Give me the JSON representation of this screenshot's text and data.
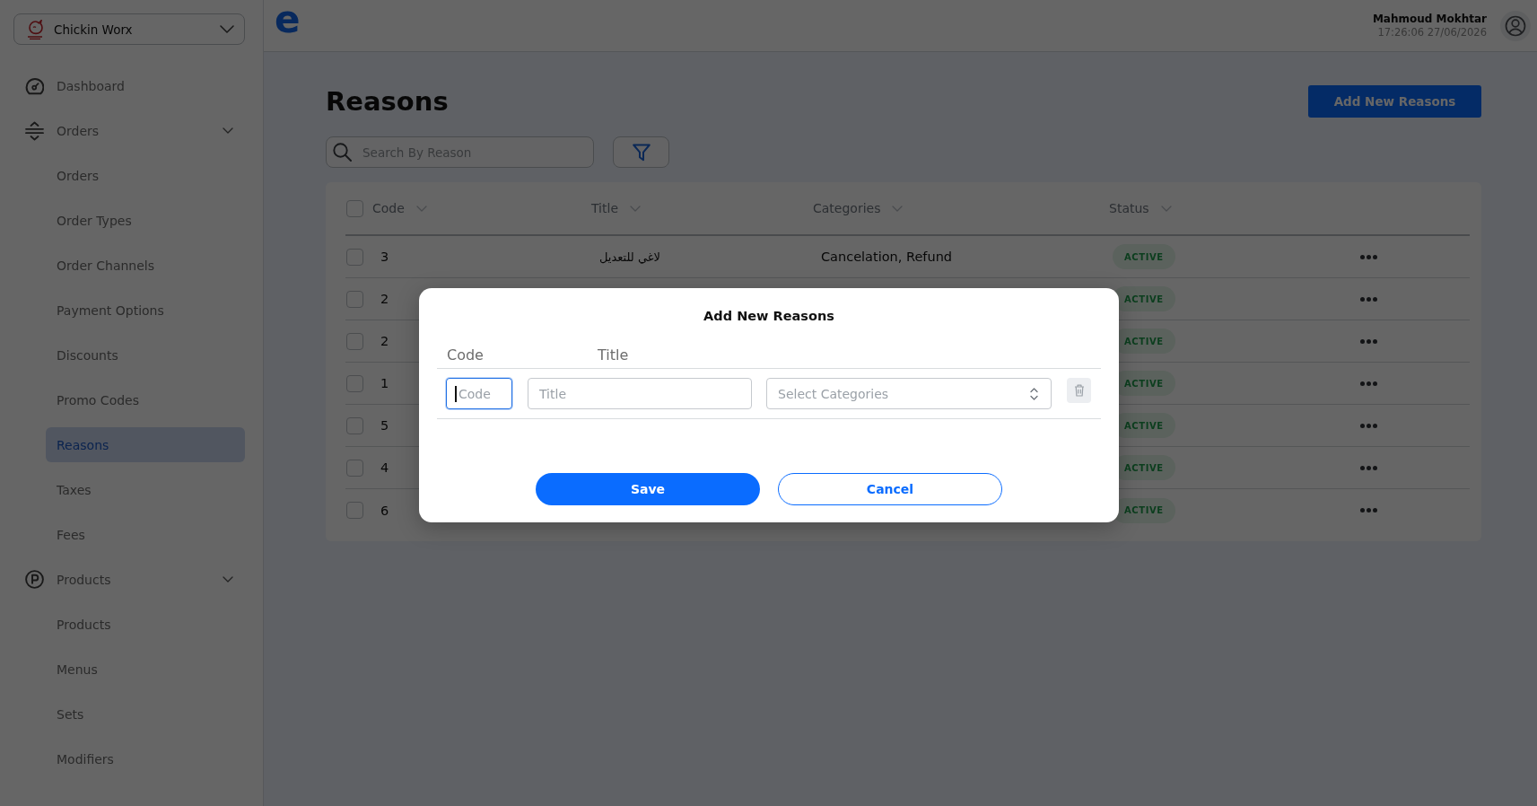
{
  "sidebar": {
    "brand_selector": {
      "label": "Chickin Worx"
    },
    "nav": [
      {
        "label": "Dashboard",
        "selected": false
      },
      {
        "label": "Orders",
        "selected": false,
        "expanded": true,
        "children": [
          {
            "label": "Orders",
            "selected": false
          },
          {
            "label": "Order Types",
            "selected": false
          },
          {
            "label": "Order Channels",
            "selected": false
          },
          {
            "label": "Payment Options",
            "selected": false
          },
          {
            "label": "Discounts",
            "selected": false
          },
          {
            "label": "Promo Codes",
            "selected": false
          },
          {
            "label": "Reasons",
            "selected": true
          },
          {
            "label": "Taxes",
            "selected": false
          },
          {
            "label": "Fees",
            "selected": false
          }
        ]
      },
      {
        "label": "Products",
        "selected": false,
        "expanded": true,
        "children": [
          {
            "label": "Products",
            "selected": false
          },
          {
            "label": "Menus",
            "selected": false
          },
          {
            "label": "Sets",
            "selected": false
          },
          {
            "label": "Modifiers",
            "selected": false
          }
        ]
      }
    ]
  },
  "header": {
    "logo": "e",
    "user": {
      "name": "Mahmoud Mokhtar",
      "timestamp": "17:26:06 27/06/2026"
    }
  },
  "page": {
    "title": "Reasons",
    "add_button": "Add New Reasons",
    "search": {
      "placeholder": "Search By Reason"
    },
    "table": {
      "select_all_checked": false,
      "columns": [
        "Code",
        "Title",
        "Categories",
        "Status"
      ],
      "rows": [
        {
          "code": "3",
          "title": "لاغي للتعديل",
          "categories": "Cancelation, Refund",
          "status": "ACTIVE",
          "checked": false
        },
        {
          "code": "2",
          "status": "ACTIVE",
          "checked": false
        },
        {
          "code": "2",
          "status": "ACTIVE",
          "checked": false
        },
        {
          "code": "1",
          "status": "ACTIVE",
          "checked": false
        },
        {
          "code": "5",
          "status": "ACTIVE",
          "checked": false
        },
        {
          "code": "4",
          "status": "ACTIVE",
          "checked": false
        },
        {
          "code": "6",
          "status": "ACTIVE",
          "checked": false
        }
      ]
    }
  },
  "modal": {
    "title": "Add New Reasons",
    "column_labels": [
      "Code",
      "Title"
    ],
    "fields": [
      {
        "kind": "text",
        "placeholder": "Code",
        "focused": true
      },
      {
        "kind": "text",
        "placeholder": "Title",
        "focused": false
      },
      {
        "kind": "select",
        "placeholder": "Select Categories",
        "focused": false
      }
    ],
    "buttons": [
      {
        "label": "Save",
        "kind": "primary"
      },
      {
        "label": "Cancel",
        "kind": "secondary"
      }
    ]
  }
}
